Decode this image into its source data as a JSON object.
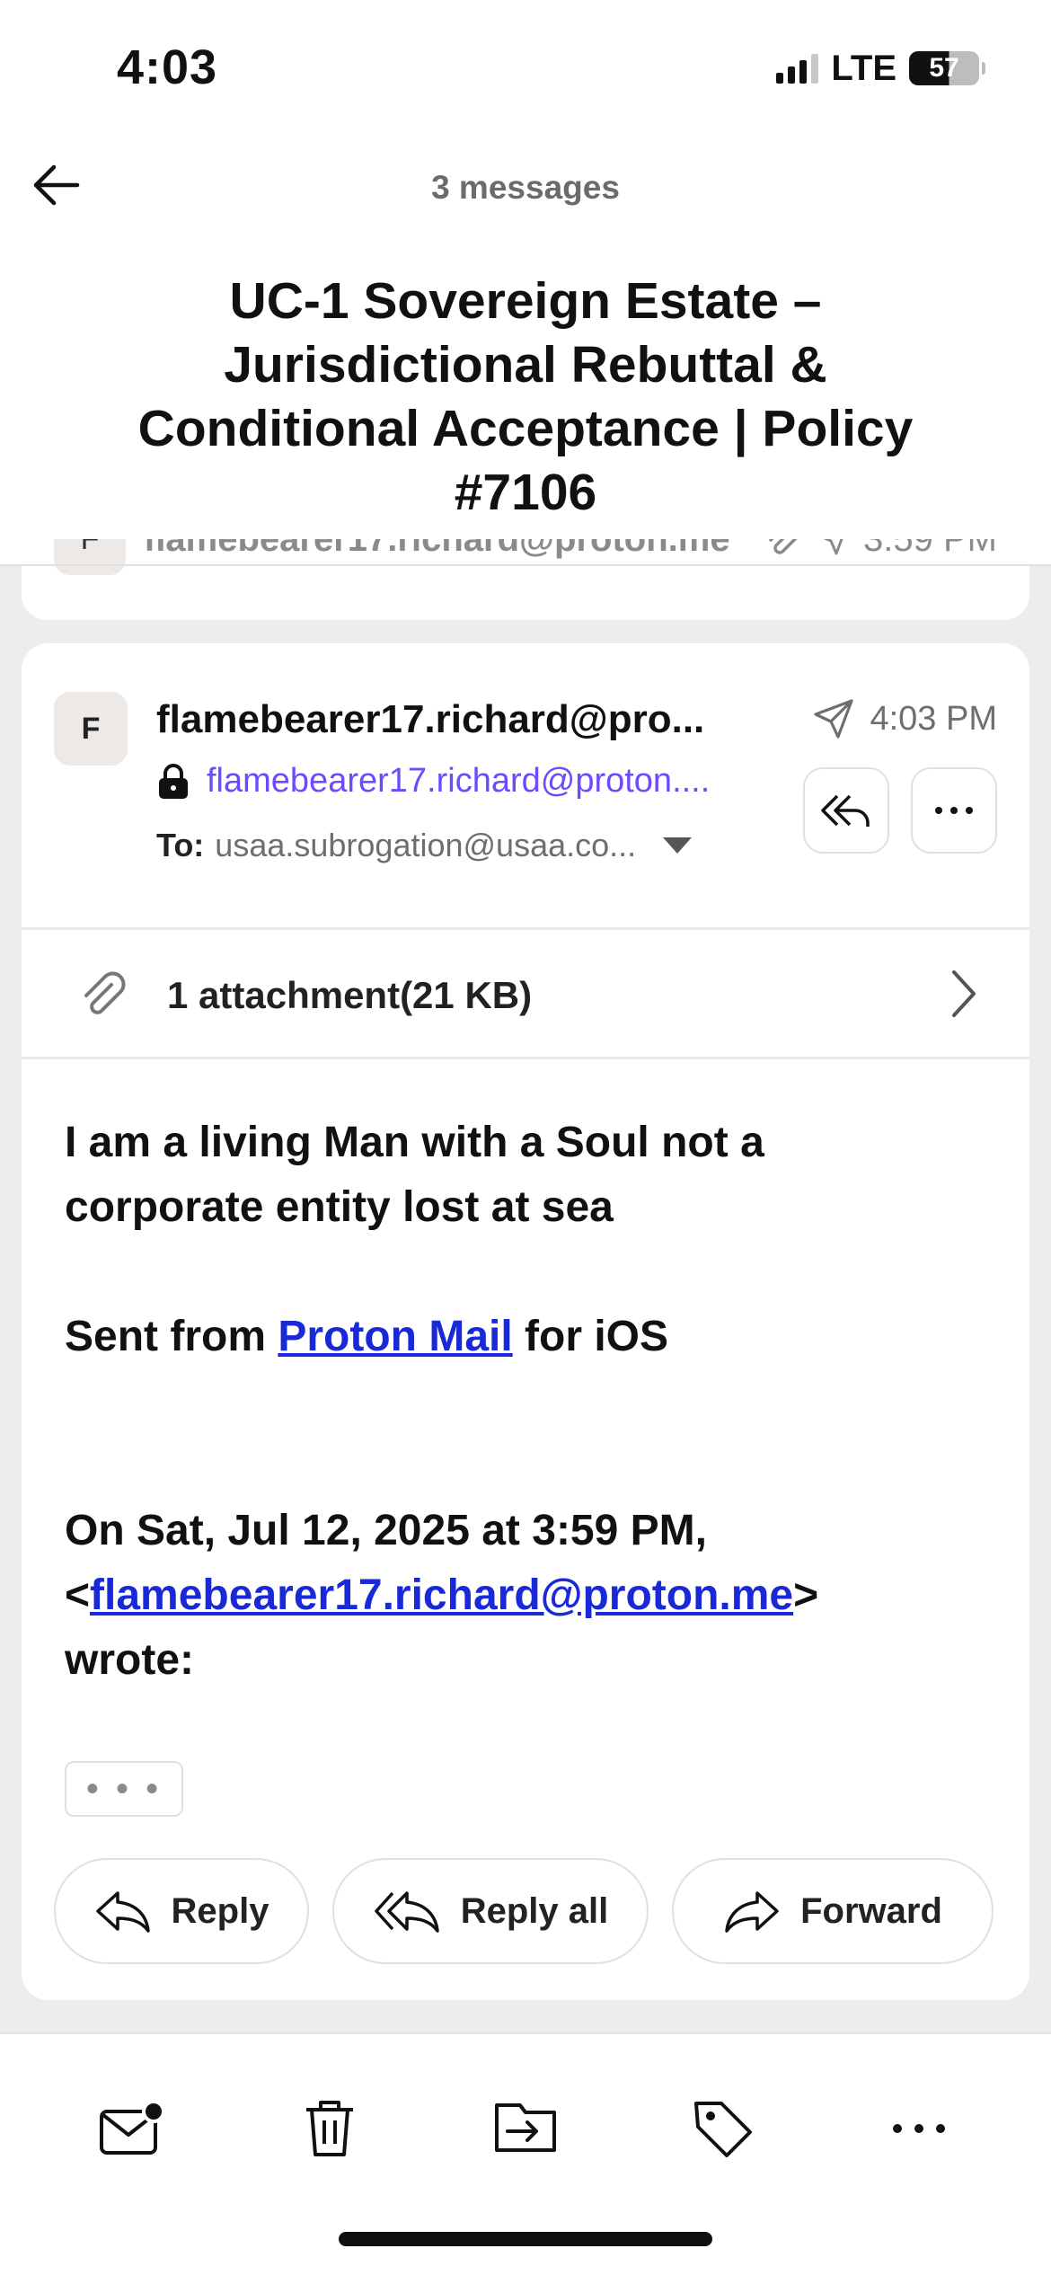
{
  "status_bar": {
    "time": "4:03",
    "network": "LTE",
    "battery": "57"
  },
  "header": {
    "message_count": "3 messages",
    "subject": "UC-1 Sovereign Estate – Jurisdictional Rebuttal & Conditional Acceptance | Policy #7106"
  },
  "collapsed_message": {
    "avatar_letter": "F",
    "sender": "flamebearer17.richard@proton.me",
    "time": "3:59 PM"
  },
  "message": {
    "avatar_letter": "F",
    "sender_name": "flamebearer17.richard@pro...",
    "sender_address": "flamebearer17.richard@proton....",
    "time": "4:03 PM",
    "to_label": "To:",
    "to_value": "usaa.subrogation@usaa.co...",
    "attachment_label": "1 attachment(21 KB)",
    "body_line1": "I am a living Man with a Soul  not a",
    "body_line2": "corporate entity lost at sea",
    "sent_prefix": "Sent from ",
    "sent_link": "Proton Mail",
    "sent_suffix": " for iOS",
    "quote_line1": "On Sat, Jul 12, 2025 at 3:59 PM,",
    "quote_lt": "<",
    "quote_email": "flamebearer17.richard@proton.me",
    "quote_gt": ">",
    "quote_line3": "wrote:",
    "quote_toggle": "• • •"
  },
  "actions": {
    "reply": "Reply",
    "reply_all": "Reply all",
    "forward": "Forward"
  },
  "toolbar": {
    "icons": [
      "mark-unread-icon",
      "trash-icon",
      "move-to-folder-icon",
      "label-icon",
      "more-icon"
    ]
  },
  "colors": {
    "accent": "#6d4aff",
    "link": "#1a29d8",
    "thread_background": "#efedeb"
  }
}
